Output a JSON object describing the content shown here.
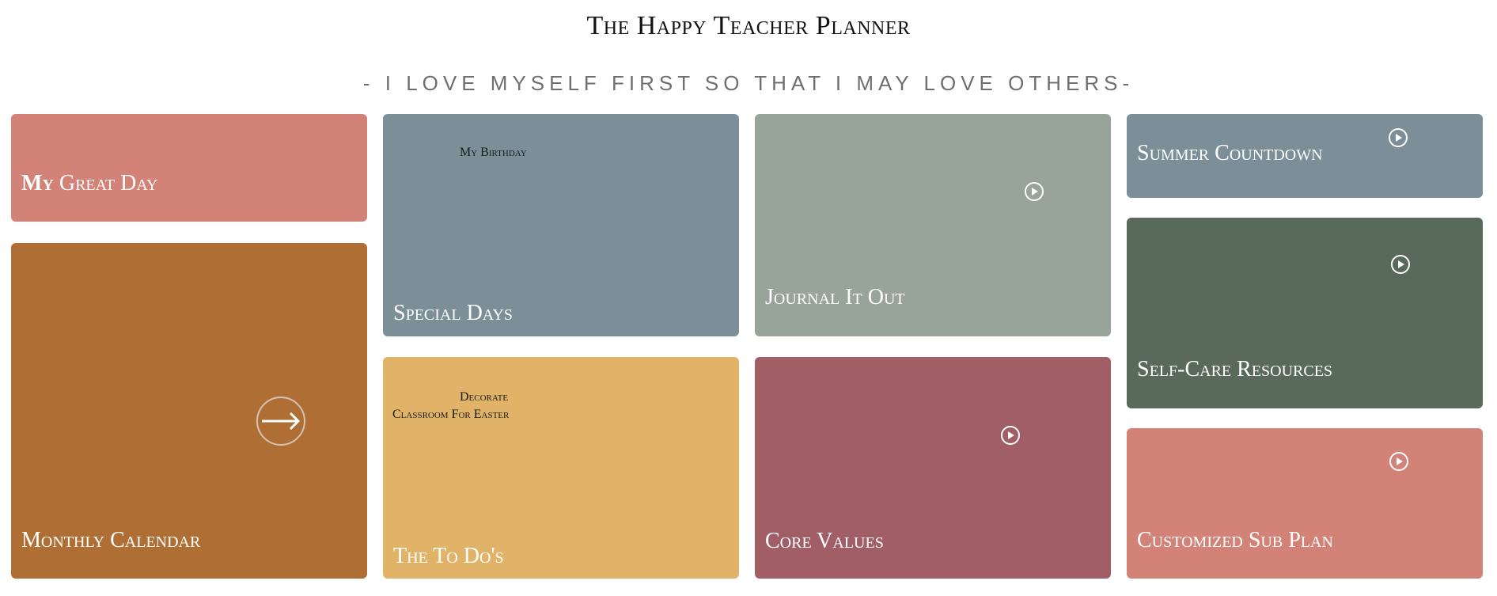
{
  "header": {
    "title": "The Happy Teacher Planner",
    "tagline": "- I LOVE MYSELF FIRST SO THAT I MAY LOVE OTHERS-"
  },
  "cards": {
    "my_great_day": {
      "label_bold": "My",
      "label_rest": " Great Day",
      "color": "#d28276"
    },
    "monthly_calendar": {
      "label": "Monthly Calendar",
      "color": "#ae6e34",
      "icon": "arrow-right-circle-icon"
    },
    "special_days": {
      "label": "Special Days",
      "note": "My Birthday",
      "color": "#7c8f98"
    },
    "todos": {
      "label": "The To Do's",
      "note_line1": "Decorate",
      "note_line2": "Classroom For Easter",
      "color": "#e1b369"
    },
    "journal": {
      "label": "Journal It Out",
      "color": "#98a399",
      "icon": "play-circle-icon"
    },
    "core_values": {
      "label": "Core Values",
      "color": "#a25e67",
      "icon": "play-circle-icon"
    },
    "summer_countdown": {
      "label": "Summer Countdown",
      "color": "#7c8f98",
      "icon": "play-circle-icon"
    },
    "self_care": {
      "label": "Self-Care Resources",
      "color": "#59695a",
      "icon": "play-circle-icon"
    },
    "sub_plan": {
      "label": "Customized Sub Plan",
      "color": "#d28276",
      "icon": "play-circle-icon"
    }
  }
}
